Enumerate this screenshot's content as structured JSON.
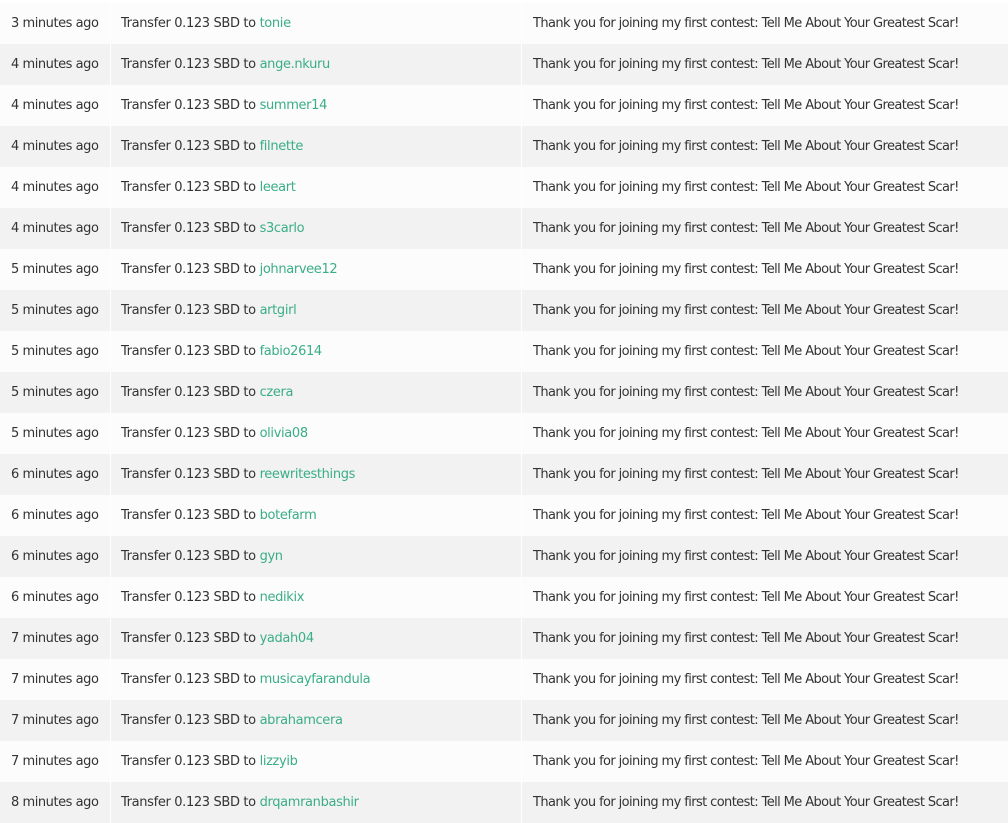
{
  "colors": {
    "link": "#3aae86",
    "text": "#333333",
    "row_light": "#fcfcfc",
    "row_dark": "#f2f2f2"
  },
  "transfers": [
    {
      "time": "3 minutes ago",
      "op_prefix": "Transfer 0.123 SBD to ",
      "to": "tonie",
      "memo": "Thank you for joining my first contest: Tell Me About Your Greatest Scar!"
    },
    {
      "time": "4 minutes ago",
      "op_prefix": "Transfer 0.123 SBD to ",
      "to": "ange.nkuru",
      "memo": "Thank you for joining my first contest: Tell Me About Your Greatest Scar!"
    },
    {
      "time": "4 minutes ago",
      "op_prefix": "Transfer 0.123 SBD to ",
      "to": "summer14",
      "memo": "Thank you for joining my first contest: Tell Me About Your Greatest Scar!"
    },
    {
      "time": "4 minutes ago",
      "op_prefix": "Transfer 0.123 SBD to ",
      "to": "filnette",
      "memo": "Thank you for joining my first contest: Tell Me About Your Greatest Scar!"
    },
    {
      "time": "4 minutes ago",
      "op_prefix": "Transfer 0.123 SBD to ",
      "to": "leeart",
      "memo": "Thank you for joining my first contest: Tell Me About Your Greatest Scar!"
    },
    {
      "time": "4 minutes ago",
      "op_prefix": "Transfer 0.123 SBD to ",
      "to": "s3carlo",
      "memo": "Thank you for joining my first contest: Tell Me About Your Greatest Scar!"
    },
    {
      "time": "5 minutes ago",
      "op_prefix": "Transfer 0.123 SBD to ",
      "to": "johnarvee12",
      "memo": "Thank you for joining my first contest: Tell Me About Your Greatest Scar!"
    },
    {
      "time": "5 minutes ago",
      "op_prefix": "Transfer 0.123 SBD to ",
      "to": "artgirl",
      "memo": "Thank you for joining my first contest: Tell Me About Your Greatest Scar!"
    },
    {
      "time": "5 minutes ago",
      "op_prefix": "Transfer 0.123 SBD to ",
      "to": "fabio2614",
      "memo": "Thank you for joining my first contest: Tell Me About Your Greatest Scar!"
    },
    {
      "time": "5 minutes ago",
      "op_prefix": "Transfer 0.123 SBD to ",
      "to": "czera",
      "memo": "Thank you for joining my first contest: Tell Me About Your Greatest Scar!"
    },
    {
      "time": "5 minutes ago",
      "op_prefix": "Transfer 0.123 SBD to ",
      "to": "olivia08",
      "memo": "Thank you for joining my first contest: Tell Me About Your Greatest Scar!"
    },
    {
      "time": "6 minutes ago",
      "op_prefix": "Transfer 0.123 SBD to ",
      "to": "reewritesthings",
      "memo": "Thank you for joining my first contest: Tell Me About Your Greatest Scar!"
    },
    {
      "time": "6 minutes ago",
      "op_prefix": "Transfer 0.123 SBD to ",
      "to": "botefarm",
      "memo": "Thank you for joining my first contest: Tell Me About Your Greatest Scar!"
    },
    {
      "time": "6 minutes ago",
      "op_prefix": "Transfer 0.123 SBD to ",
      "to": "gyn",
      "memo": "Thank you for joining my first contest: Tell Me About Your Greatest Scar!"
    },
    {
      "time": "6 minutes ago",
      "op_prefix": "Transfer 0.123 SBD to ",
      "to": "nedikix",
      "memo": "Thank you for joining my first contest: Tell Me About Your Greatest Scar!"
    },
    {
      "time": "7 minutes ago",
      "op_prefix": "Transfer 0.123 SBD to ",
      "to": "yadah04",
      "memo": "Thank you for joining my first contest: Tell Me About Your Greatest Scar!"
    },
    {
      "time": "7 minutes ago",
      "op_prefix": "Transfer 0.123 SBD to ",
      "to": "musicayfarandula",
      "memo": "Thank you for joining my first contest: Tell Me About Your Greatest Scar!"
    },
    {
      "time": "7 minutes ago",
      "op_prefix": "Transfer 0.123 SBD to ",
      "to": "abrahamcera",
      "memo": "Thank you for joining my first contest: Tell Me About Your Greatest Scar!"
    },
    {
      "time": "7 minutes ago",
      "op_prefix": "Transfer 0.123 SBD to ",
      "to": "lizzyib",
      "memo": "Thank you for joining my first contest: Tell Me About Your Greatest Scar!"
    },
    {
      "time": "8 minutes ago",
      "op_prefix": "Transfer 0.123 SBD to ",
      "to": "drqamranbashir",
      "memo": "Thank you for joining my first contest: Tell Me About Your Greatest Scar!"
    }
  ]
}
